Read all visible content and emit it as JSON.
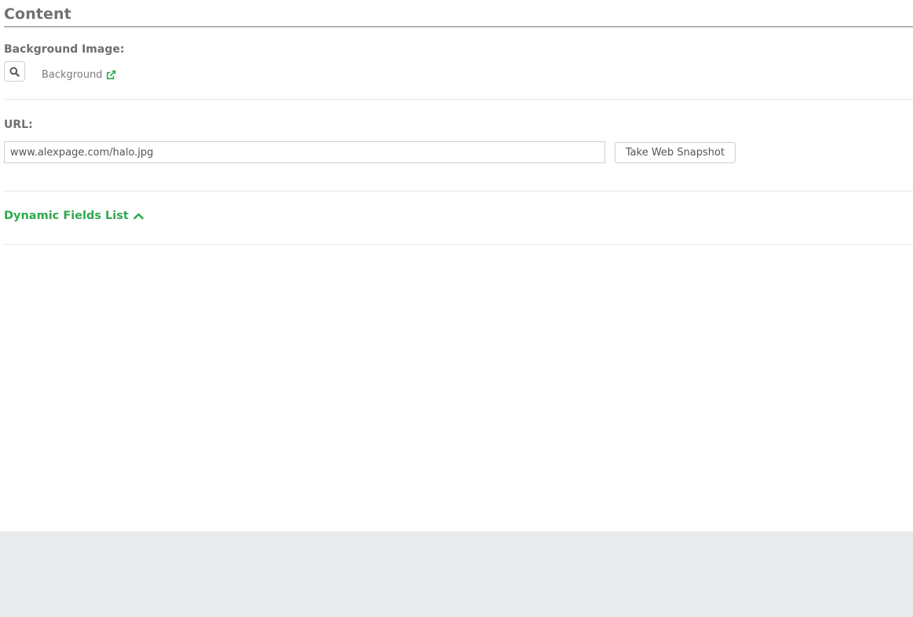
{
  "content": {
    "title": "Content"
  },
  "background_image": {
    "label": "Background Image:",
    "search_icon": "search-icon",
    "link_text": "Background",
    "link_icon": "external-link-icon"
  },
  "url": {
    "label": "URL:",
    "value": "www.alexpage.com/halo.jpg",
    "snapshot_button": "Take Web Snapshot"
  },
  "dynamic_fields": {
    "label": "Dynamic Fields List",
    "toggle_icon": "chevron-up-icon",
    "expanded": true
  },
  "colors": {
    "accent": "#2fa84f",
    "heading": "#707070",
    "footer_bg": "#e9eaec"
  }
}
